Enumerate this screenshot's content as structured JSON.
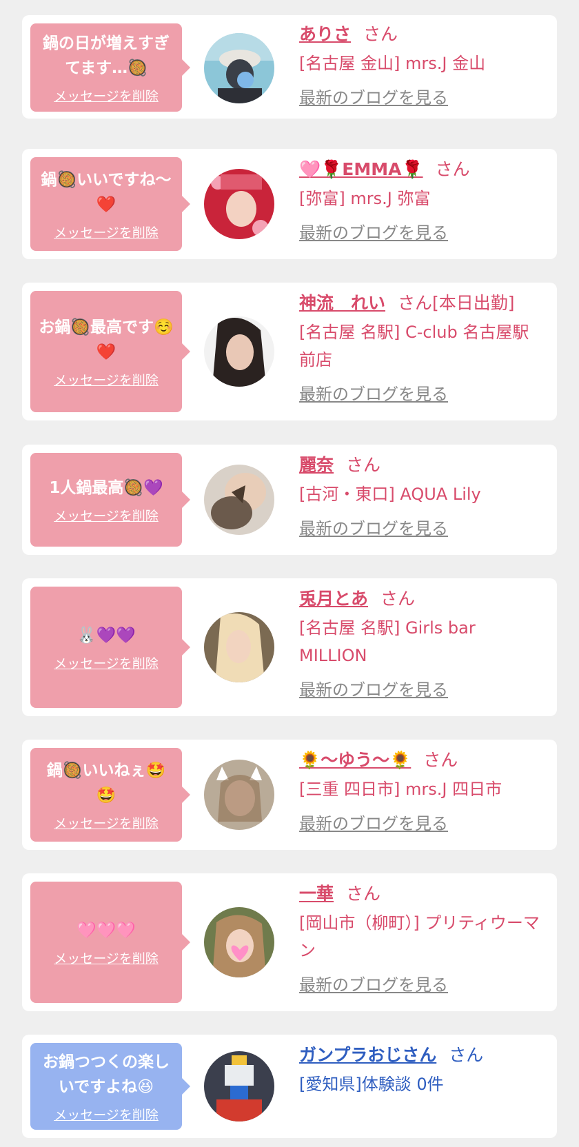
{
  "colors": {
    "bubble_pink": "#ef9fab",
    "bubble_blue": "#97b3f0",
    "name_pink": "#d84b6b",
    "name_blue": "#2f5ec0",
    "link_gray": "#888888",
    "page_bg": "#efefef"
  },
  "messages": [
    {
      "message": "鍋の日が増えすぎてます…🥘",
      "delete_label": "メッセージを削除",
      "name": "ありさ",
      "honorific": "さん",
      "shop": "[名古屋 金山] mrs.J 金山",
      "blog_label": "最新のブログを見る",
      "theme": "pink"
    },
    {
      "message": "鍋🥘いいですね〜❤️",
      "delete_label": "メッセージを削除",
      "name": "🩷🌹EMMA🌹",
      "honorific": "さん",
      "shop": "[弥富] mrs.J 弥富",
      "blog_label": "最新のブログを見る",
      "theme": "pink"
    },
    {
      "message": "お鍋🥘最高です☺️❤️",
      "delete_label": "メッセージを削除",
      "name": "神流　れい",
      "honorific": "さん[本日出勤]",
      "shop": "[名古屋 名駅] C-club 名古屋駅前店",
      "blog_label": "最新のブログを見る",
      "theme": "pink"
    },
    {
      "message": "1人鍋最高🥘💜",
      "delete_label": "メッセージを削除",
      "name": "麗奈",
      "honorific": "さん",
      "shop": "[古河・東口] AQUA Lily",
      "blog_label": "最新のブログを見る",
      "theme": "pink"
    },
    {
      "message": "🐰💜💜",
      "delete_label": "メッセージを削除",
      "name": "兎月とあ",
      "honorific": "さん",
      "shop": "[名古屋 名駅] Girls bar MILLION",
      "blog_label": "最新のブログを見る",
      "theme": "pink"
    },
    {
      "message": "鍋🥘いいねぇ🤩🤩",
      "delete_label": "メッセージを削除",
      "name": "🌻〜ゆう〜🌻",
      "honorific": "さん",
      "shop": "[三重 四日市] mrs.J 四日市",
      "blog_label": "最新のブログを見る",
      "theme": "pink"
    },
    {
      "message": "🩷🩷🩷",
      "delete_label": "メッセージを削除",
      "name": "一華",
      "honorific": "さん",
      "shop": "[岡山市（柳町）] プリティウーマン",
      "blog_label": "最新のブログを見る",
      "theme": "pink"
    },
    {
      "message": "お鍋つつくの楽しいですよね😆",
      "delete_label": "メッセージを削除",
      "name": "ガンプラおじさん",
      "honorific": "さん",
      "shop": "[愛知県]体験談 0件",
      "blog_label": "",
      "theme": "blue"
    }
  ]
}
